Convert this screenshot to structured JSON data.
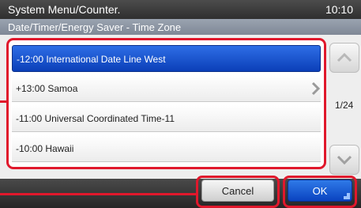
{
  "header": {
    "title": "System Menu/Counter.",
    "time": "10:10"
  },
  "subheader": {
    "title": "Date/Timer/Energy Saver - Time Zone"
  },
  "list": {
    "items": [
      {
        "label": "-12:00 International Date Line West",
        "selected": true
      },
      {
        "label": "+13:00 Samoa",
        "has_chevron": true
      },
      {
        "label": "-11:00 Universal Coordinated Time-11"
      },
      {
        "label": "-10:00 Hawaii"
      }
    ]
  },
  "pager": {
    "indicator": "1/24"
  },
  "buttons": {
    "cancel": "Cancel",
    "ok": "OK"
  },
  "colors": {
    "selection": "#1a52d0",
    "highlight_frame": "#e0182c"
  }
}
